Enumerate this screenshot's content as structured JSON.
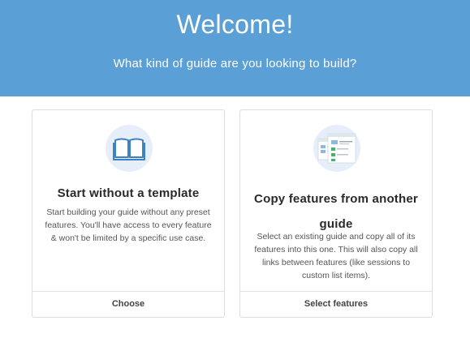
{
  "header": {
    "title": "Welcome!",
    "subtitle": "What kind of guide are you looking to build?"
  },
  "cards": [
    {
      "heading": "Start without a template",
      "description": "Start building your guide without any preset features. You'll have access to every feature & won't be limited by a specific use case.",
      "action": "Choose",
      "icon": "book-icon"
    },
    {
      "heading": "Copy features from another guide",
      "description": "Select an existing guide and copy all of its features into this one. This will also copy all links between features (like sessions to custom list items).",
      "action": "Select features",
      "icon": "copy-screens-icon"
    }
  ],
  "colors": {
    "header_bg": "#5a9fd6",
    "icon_circle": "#e6eff9",
    "border": "#dcdcdc"
  }
}
